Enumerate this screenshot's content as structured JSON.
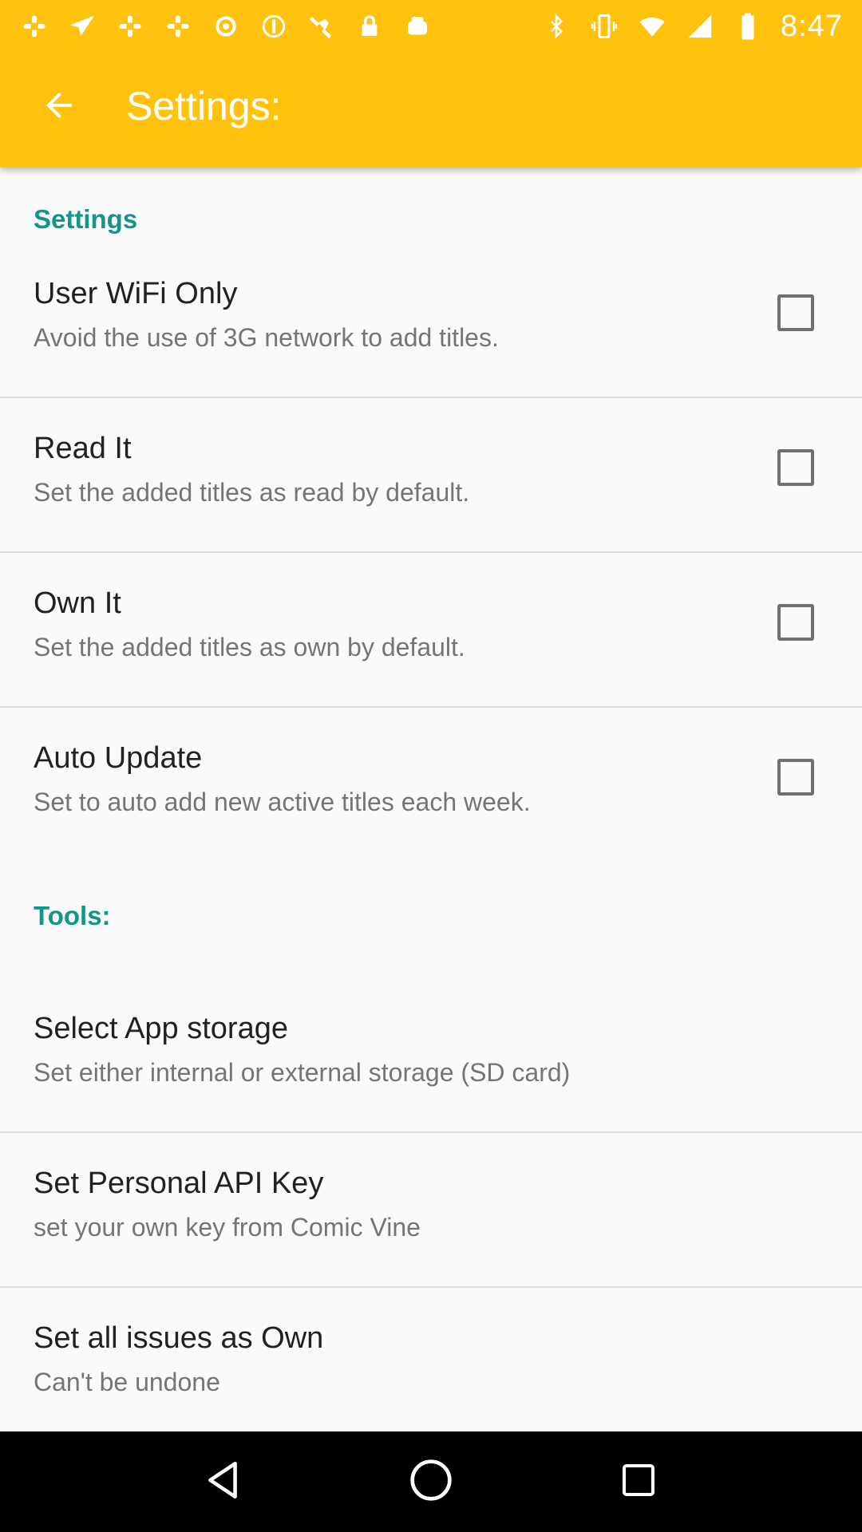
{
  "status_bar": {
    "time": "8:47",
    "left_icons": [
      "slack-icon",
      "send-icon",
      "slack-icon",
      "slack-icon",
      "circle-icon",
      "circle-icon",
      "satellite-icon",
      "lock-icon",
      "android-icon"
    ],
    "right_icons": [
      "bluetooth-icon",
      "vibrate-icon",
      "wifi-icon",
      "signal-icon",
      "battery-icon"
    ]
  },
  "toolbar": {
    "title": "Settings:",
    "back_icon": "arrow-back-icon"
  },
  "sections": {
    "settings": {
      "header": "Settings",
      "items": [
        {
          "title": "User WiFi Only",
          "summary": "Avoid the use of 3G network to add titles.",
          "checked": false
        },
        {
          "title": "Read It",
          "summary": "Set the added titles as read by default.",
          "checked": false
        },
        {
          "title": "Own It",
          "summary": "Set the added titles as own by default.",
          "checked": false
        },
        {
          "title": "Auto Update",
          "summary": "Set to auto add new active titles each week.",
          "checked": false
        }
      ]
    },
    "tools": {
      "header": "Tools:",
      "items": [
        {
          "title": "Select App storage",
          "summary": "Set either internal or external storage (SD card)"
        },
        {
          "title": "Set Personal API Key",
          "summary": "set your own key from Comic Vine"
        },
        {
          "title": "Set all issues as Own",
          "summary": "Can't be undone"
        }
      ]
    }
  },
  "colors": {
    "appbar": "#ffc20f",
    "accent": "#129688",
    "background": "#fafafa"
  },
  "navbar": {
    "icons": [
      "back-triangle-icon",
      "home-circle-icon",
      "recents-square-icon"
    ]
  }
}
